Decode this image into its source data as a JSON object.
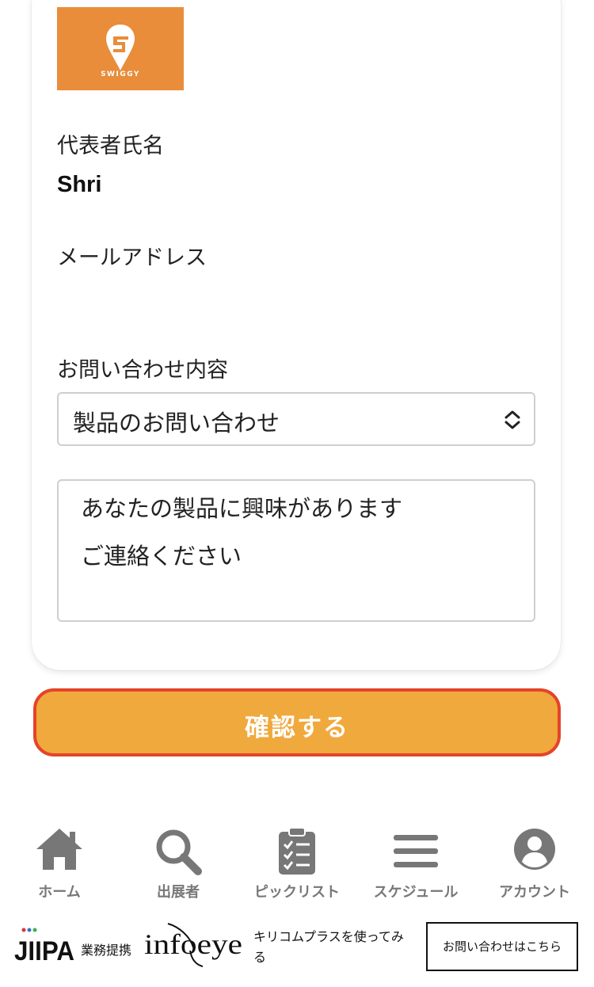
{
  "company": {
    "logo_text": "SWIGGY",
    "logo_color": "#e98d3a"
  },
  "form": {
    "rep_name_label": "代表者氏名",
    "rep_name_value": "Shri",
    "email_label": "メールアドレス",
    "inquiry_label": "お問い合わせ内容",
    "inquiry_select_value": "製品のお問い合わせ",
    "message_line1": "あなたの製品に興味があります",
    "message_line2": "ご連絡ください",
    "confirm_label": "確認する"
  },
  "nav": {
    "items": [
      {
        "label": "ホーム",
        "icon": "home-icon"
      },
      {
        "label": "出展者",
        "icon": "search-icon"
      },
      {
        "label": "ピックリスト",
        "icon": "checklist-icon"
      },
      {
        "label": "スケジュール",
        "icon": "menu-icon"
      },
      {
        "label": "アカウント",
        "icon": "account-icon"
      }
    ]
  },
  "footer": {
    "jiipa_logo": "JIIPA",
    "partnership_text": "業務提携",
    "infoeye_logo": "infoeye",
    "kirico_text": "キリコムプラスを使ってみる",
    "contact_button": "お問い合わせはこちら"
  },
  "colors": {
    "button_fill": "#f0a93c",
    "button_border": "#e4442a",
    "nav_gray": "#777777"
  }
}
